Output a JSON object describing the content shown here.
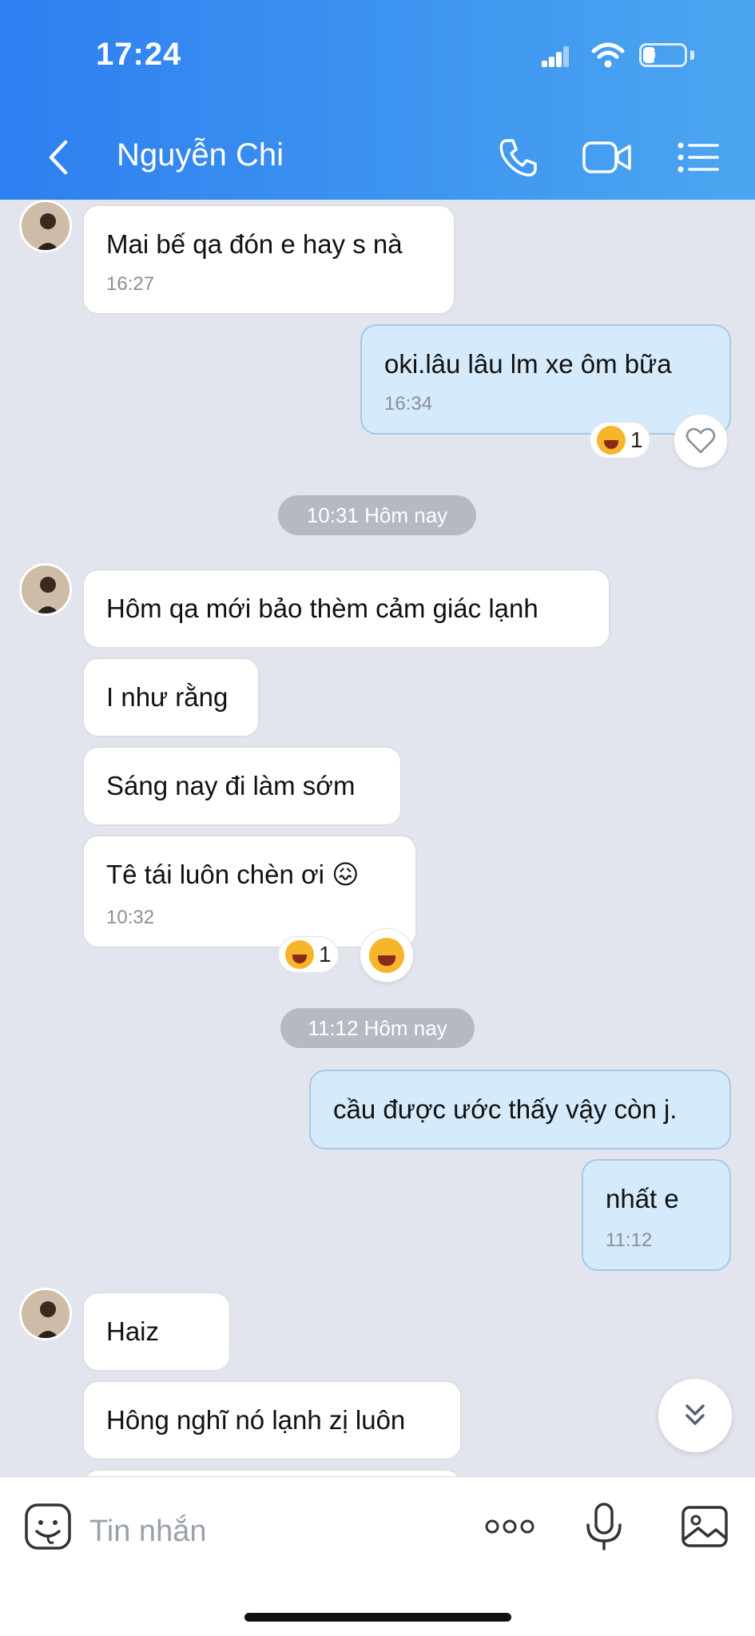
{
  "status_bar": {
    "time": "17:24",
    "battery": "27",
    "battery_level": 0.27
  },
  "header": {
    "title": "Nguyễn Chi",
    "back_icon": "chevron-left-icon",
    "call_icon": "phone-icon",
    "video_icon": "video-camera-icon",
    "menu_icon": "list-menu-icon"
  },
  "messages": [
    {
      "text": "Mai bế qa đón e hay s nà",
      "time": "16:27"
    },
    {
      "text": "oki.lâu lâu lm xe ôm bữa",
      "time": "16:34",
      "reaction_count": "1"
    },
    {
      "text": "Hôm qa mới bảo thèm cảm giác lạnh"
    },
    {
      "text": "I như rằng"
    },
    {
      "text": "Sáng nay đi làm sớm"
    },
    {
      "text": "Tê tái luôn chèn ơi",
      "emoji": "😖",
      "time": "10:32",
      "reaction_count": "1"
    },
    {
      "text": "cầu được ước thấy vậy còn j."
    },
    {
      "text": "nhất e",
      "time": "11:12"
    },
    {
      "text": "Haiz"
    },
    {
      "text": "Hông nghĩ nó lạnh zị luôn"
    }
  ],
  "separators": [
    "10:31 Hôm nay",
    "11:12 Hôm nay"
  ],
  "composer": {
    "placeholder": "Tin nhắn"
  }
}
